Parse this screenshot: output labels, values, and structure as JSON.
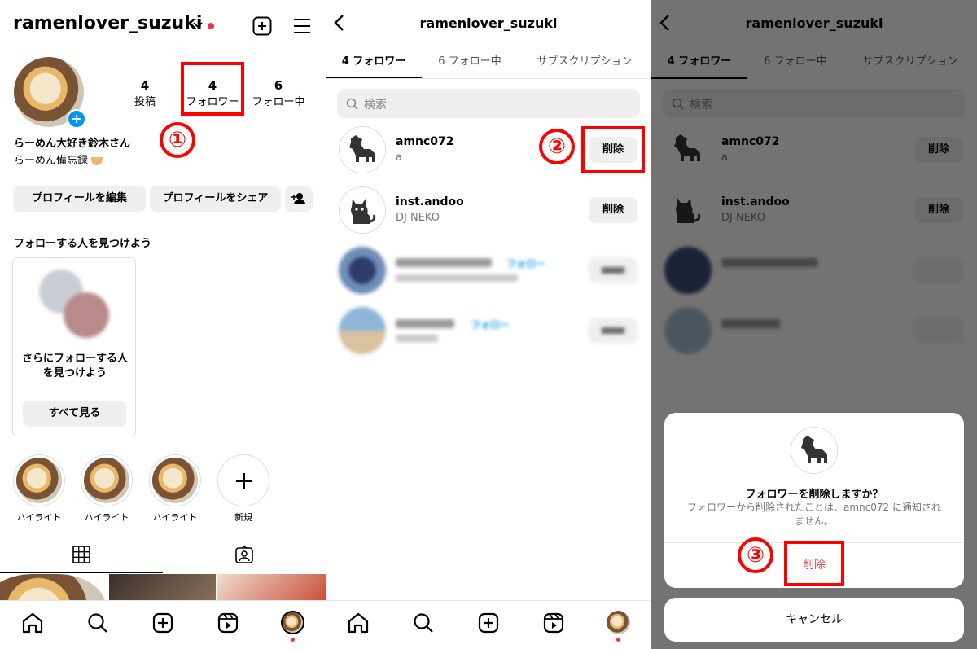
{
  "colors": {
    "annotation": "#ff0000",
    "accent": "#0095f6",
    "destructive": "#ed4956",
    "notification": "#ff3040"
  },
  "profile": {
    "username": "ramenlover_suzuki",
    "stats": [
      {
        "count": "4",
        "label": "投稿"
      },
      {
        "count": "4",
        "label": "フォロワー"
      },
      {
        "count": "6",
        "label": "フォロー中"
      }
    ],
    "display_name": "らーめん大好き鈴木さん",
    "bio": "らーめん備忘録",
    "edit_profile_label": "プロフィールを編集",
    "share_profile_label": "プロフィールをシェア",
    "discover_heading": "フォローする人を見つけよう",
    "discover_card_text": "さらにフォローする人を見つけよう",
    "see_all_label": "すべて見る",
    "highlights": [
      "ハイライト",
      "ハイライト",
      "ハイライト"
    ],
    "new_highlight_label": "新規"
  },
  "followers": {
    "title": "ramenlover_suzuki",
    "tabs": [
      "4 フォロワー",
      "6 フォロー中",
      "サブスクリプション"
    ],
    "search_placeholder": "検索",
    "rows": [
      {
        "username": "amnc072",
        "subtitle": "a",
        "button": "削除"
      },
      {
        "username": "inst.andoo",
        "subtitle": "DJ NEKO",
        "button": "削除"
      }
    ],
    "blurred_follow_label": "フォロー"
  },
  "dialog": {
    "title": "フォロワーを削除しますか？",
    "message": "フォロワーから削除されたことは、amnc072 に通知されません。",
    "confirm_label": "削除",
    "cancel_label": "キャンセル"
  },
  "annotations": [
    "①",
    "②",
    "③"
  ]
}
